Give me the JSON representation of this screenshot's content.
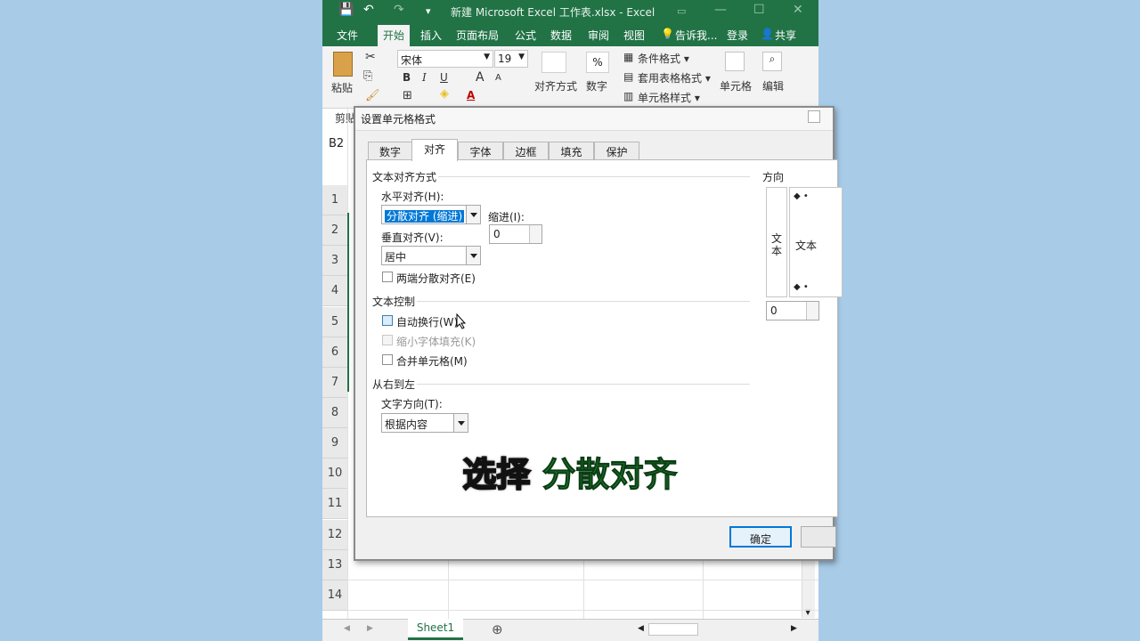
{
  "window": {
    "title": "新建 Microsoft Excel 工作表.xlsx - Excel"
  },
  "menus": [
    "文件",
    "开始",
    "插入",
    "页面布局",
    "公式",
    "数据",
    "审阅",
    "视图",
    "告诉我...",
    "登录",
    "共享"
  ],
  "active_menu": "开始",
  "ribbon": {
    "paste": "粘贴",
    "clipboard_group": "剪贴",
    "font_name": "宋体",
    "font_size": "19",
    "bold": "B",
    "italic": "I",
    "underline": "U",
    "grow_font": "A",
    "shrink_font": "A",
    "font_color": "A",
    "alignment": "对齐方式",
    "number": "数字",
    "percent": "%",
    "conditional_format": "条件格式 ▾",
    "table_format": "套用表格格式 ▾",
    "cell_style": "单元格样式 ▾",
    "cells": "单元格",
    "editing": "编辑"
  },
  "name_box": "B2",
  "rows": [
    "1",
    "2",
    "3",
    "4",
    "5",
    "6",
    "7",
    "8",
    "9",
    "10",
    "11",
    "12",
    "13",
    "14"
  ],
  "sheet_tab": "Sheet1",
  "dialog": {
    "title": "设置单元格格式",
    "tabs": [
      "数字",
      "对齐",
      "字体",
      "边框",
      "填充",
      "保护"
    ],
    "active_tab": "对齐",
    "text_alignment_section": "文本对齐方式",
    "horizontal_label": "水平对齐(H):",
    "horizontal_value": "分散对齐 (缩进)",
    "indent_label": "缩进(I):",
    "indent_value": "0",
    "vertical_label": "垂直对齐(V):",
    "vertical_value": "居中",
    "justify_distributed": "两端分散对齐(E)",
    "text_control_section": "文本控制",
    "wrap_text": "自动换行(W)",
    "shrink_to_fit": "缩小字体填充(K)",
    "merge_cells": "合并单元格(M)",
    "rtl_section": "从右到左",
    "text_direction_label": "文字方向(T):",
    "text_direction_value": "根据内容",
    "orientation_section": "方向",
    "orientation_vertical_text": "文本",
    "orientation_text": "文本",
    "degrees_value": "0",
    "ok": "确定"
  },
  "caption": {
    "prefix": "选择",
    "highlight": "分散对齐"
  }
}
